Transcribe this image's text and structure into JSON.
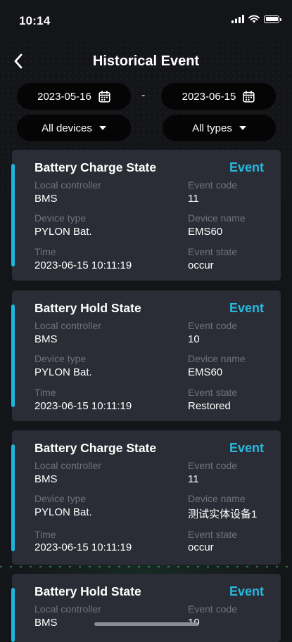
{
  "status_bar": {
    "time": "10:14"
  },
  "header": {
    "title": "Historical Event"
  },
  "filters": {
    "start_date": "2023-05-16",
    "separator": "-",
    "end_date": "2023-06-15",
    "device": "All devices",
    "type": "All types"
  },
  "labels": {
    "local_controller": "Local controller",
    "event_code": "Event code",
    "device_type": "Device type",
    "device_name": "Device name",
    "time": "Time",
    "event_state": "Event state"
  },
  "events": [
    {
      "title": "Battery Charge State",
      "tag": "Event",
      "local_controller": "BMS",
      "event_code": "11",
      "device_type": "PYLON Bat.",
      "device_name": "EMS60",
      "time": "2023-06-15 10:11:19",
      "event_state": "occur"
    },
    {
      "title": "Battery Hold State",
      "tag": "Event",
      "local_controller": "BMS",
      "event_code": "10",
      "device_type": "PYLON Bat.",
      "device_name": "EMS60",
      "time": "2023-06-15 10:11:19",
      "event_state": "Restored"
    },
    {
      "title": "Battery Charge State",
      "tag": "Event",
      "local_controller": "BMS",
      "event_code": "11",
      "device_type": "PYLON Bat.",
      "device_name": "测试实体设备1",
      "time": "2023-06-15 10:11:19",
      "event_state": "occur"
    },
    {
      "title": "Battery Hold State",
      "tag": "Event",
      "local_controller": "BMS",
      "event_code": "10"
    }
  ],
  "colors": {
    "accent": "#1fb5dc",
    "tag": "#27b9e0",
    "card": "#2a2d35",
    "background": "#141518",
    "pill": "#050506"
  },
  "icons": {
    "back": "chevron-left-icon",
    "calendar": "calendar-icon",
    "caret": "caret-down-icon",
    "wifi": "wifi-icon",
    "signal": "signal-icon",
    "battery": "battery-icon"
  }
}
